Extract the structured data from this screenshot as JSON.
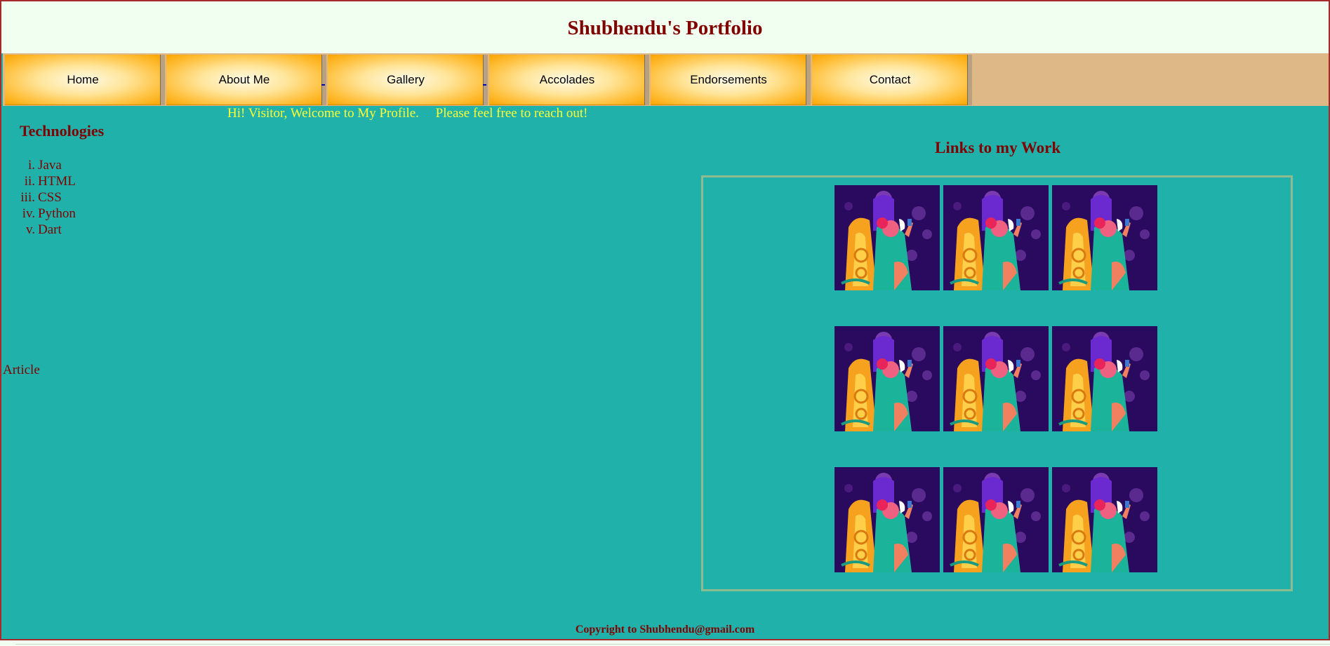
{
  "header": {
    "title": "Shubhendu's Portfolio"
  },
  "nav": {
    "items": [
      {
        "label": "Home"
      },
      {
        "label": "About Me"
      },
      {
        "label": "Gallery"
      },
      {
        "label": "Accolades"
      },
      {
        "label": "Endorsements"
      },
      {
        "label": "Contact"
      }
    ]
  },
  "welcome": {
    "text": "Hi! Visitor, Welcome to My Profile.     Please feel free to reach out!"
  },
  "technologies": {
    "heading": "Technologies",
    "items": [
      {
        "num": "i.",
        "label": "Java"
      },
      {
        "num": "ii.",
        "label": "HTML"
      },
      {
        "num": "iii.",
        "label": "CSS"
      },
      {
        "num": "iv.",
        "label": "Python"
      },
      {
        "num": "v.",
        "label": "Dart"
      }
    ]
  },
  "article": {
    "label": "Article"
  },
  "work": {
    "heading": "Links to my Work",
    "thumbnails": [
      {
        "icon": "people-illustration-icon"
      },
      {
        "icon": "people-illustration-icon"
      },
      {
        "icon": "people-illustration-icon"
      },
      {
        "icon": "people-illustration-icon"
      },
      {
        "icon": "people-illustration-icon"
      },
      {
        "icon": "people-illustration-icon"
      },
      {
        "icon": "people-illustration-icon"
      },
      {
        "icon": "people-illustration-icon"
      },
      {
        "icon": "people-illustration-icon"
      }
    ]
  },
  "footer": {
    "copyright": "Copyright to Shubhendu@gmail.com"
  },
  "colors": {
    "page_background": "#20b2aa",
    "header_background": "#f0fff0",
    "title_color": "#800000",
    "welcome_color": "#ffff33",
    "nav_strip": "#deb887",
    "nav_button": "#ffbf3a",
    "frame_border": "#a52a2a",
    "work_box_border": "#8fbc8f",
    "thumbnail_background": "#2a0a5e"
  }
}
